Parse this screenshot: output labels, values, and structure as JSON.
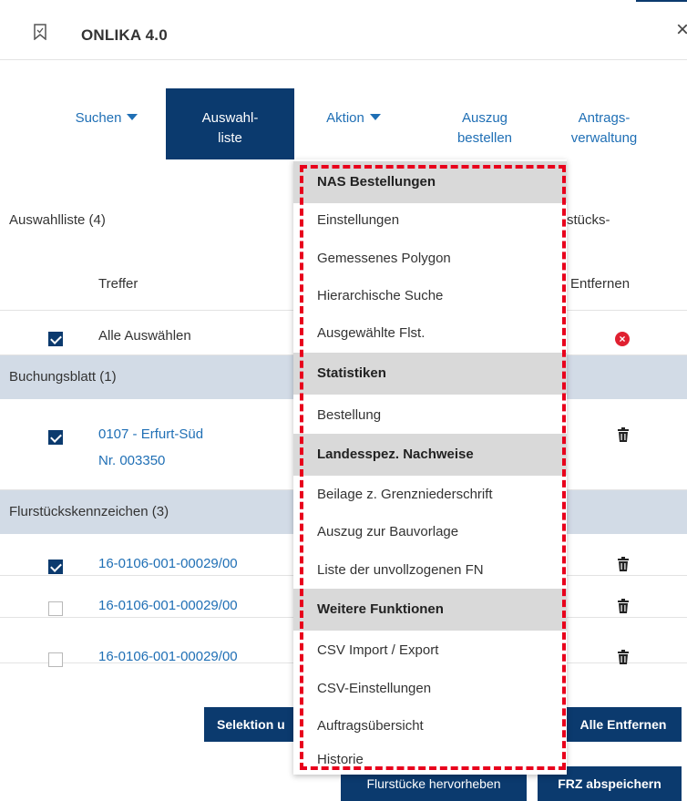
{
  "header": {
    "title": "ONLIKA 4.0",
    "close": "×"
  },
  "tabs": [
    {
      "line1": "Suchen",
      "line2": ""
    },
    {
      "line1": "Auswahl-",
      "line2": "liste"
    },
    {
      "line1": "Aktion",
      "line2": ""
    },
    {
      "line1": "Auszug",
      "line2": "bestellen"
    },
    {
      "line1": "Antrags-",
      "line2": "verwaltung"
    }
  ],
  "list": {
    "title": "Auswahlliste (4)",
    "partial_col": "stücks-",
    "col_treffer": "Treffer",
    "col_entfernen": "Entfernen",
    "select_all": "Alle Auswählen",
    "group1": "Buchungsblatt (1)",
    "row1_line1": "0107 - Erfurt-Süd",
    "row1_line2": "Nr. 003350",
    "group2": "Flurstückskennzeichen (3)",
    "row2": "16-0106-001-00029/00",
    "row3": "16-0106-001-00029/00",
    "row4": "16-0106-001-00029/00",
    "remove_all_icon": "×"
  },
  "buttons": {
    "selektion": "Selektion u",
    "alle_entfernen": "Alle Entfernen",
    "hervorheben": "Flurstücke hervorheben",
    "frz": "FRZ abspeichern"
  },
  "menu": {
    "sec1": "NAS Bestellungen",
    "i1": "Einstellungen",
    "i2": "Gemessenes Polygon",
    "i3": "Hierarchische Suche",
    "i4": "Ausgewählte Flst.",
    "sec2": "Statistiken",
    "i5": "Bestellung",
    "sec3": "Landesspez. Nachweise",
    "i6": "Beilage z. Grenzniederschrift",
    "i7": "Auszug zur Bauvorlage",
    "i8": "Liste der unvollzogenen FN",
    "sec4": "Weitere Funktionen",
    "i9": "CSV Import / Export",
    "i10": "CSV-Einstellungen",
    "i11": "Auftragsübersicht",
    "i12": "Historie"
  },
  "colors": {
    "navy": "#0b3a6e",
    "link": "#1f6fb5",
    "group_bg": "#d2dbe6",
    "menu_section": "#d9d9d9",
    "highlight": "#e8001c"
  }
}
